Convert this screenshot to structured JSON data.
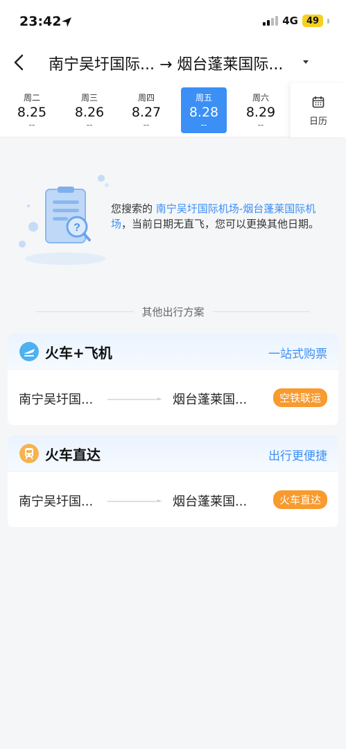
{
  "status_bar": {
    "time": "23:42",
    "network": "4G",
    "battery": "49"
  },
  "header": {
    "route_title": "南宁吴圩国际... → 烟台蓬莱国际..."
  },
  "dates": [
    {
      "weekday": "周二",
      "date": "8.25",
      "price": "--",
      "active": false
    },
    {
      "weekday": "周三",
      "date": "8.26",
      "price": "--",
      "active": false
    },
    {
      "weekday": "周四",
      "date": "8.27",
      "price": "--",
      "active": false
    },
    {
      "weekday": "周五",
      "date": "8.28",
      "price": "--",
      "active": true
    },
    {
      "weekday": "周六",
      "date": "8.29",
      "price": "--",
      "active": false
    }
  ],
  "calendar": {
    "label": "日历"
  },
  "empty": {
    "prefix": "您搜索的 ",
    "route": "南宁吴圩国际机场-烟台蓬莱国际机场",
    "suffix": "，当前日期无直飞，您可以更换其他日期。"
  },
  "other_title": "其他出行方案",
  "cards": [
    {
      "title": "火车+飞机",
      "link": "一站式购票",
      "from": "南宁吴圩国...",
      "to": "烟台蓬莱国...",
      "badge": "空铁联运"
    },
    {
      "title": "火车直达",
      "link": "出行更便捷",
      "from": "南宁吴圩国...",
      "to": "烟台蓬莱国...",
      "badge": "火车直达"
    }
  ],
  "colors": {
    "accent": "#3b8ff5",
    "badge": "#f89a2e"
  }
}
